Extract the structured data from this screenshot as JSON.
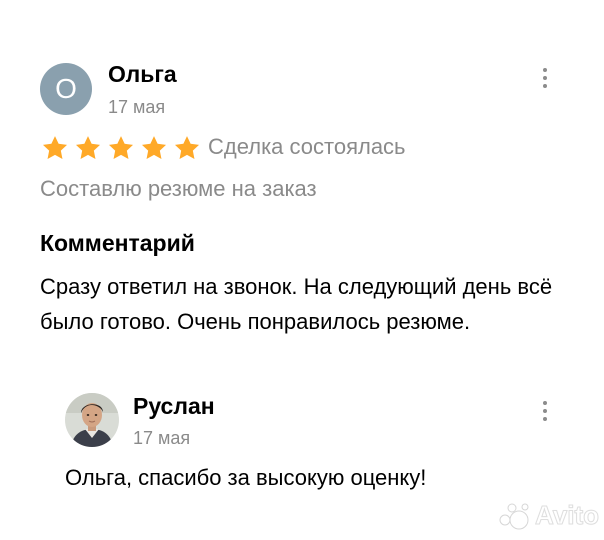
{
  "review": {
    "avatar_letter": "О",
    "avatar_color": "#8aa0ae",
    "author": "Ольга",
    "date": "17 мая",
    "menu_icon": "more-vertical-icon",
    "rating": 5,
    "rating_max": 5,
    "star_color": "#ffa928",
    "deal_status": "Сделка состоялась",
    "service": "Составлю резюме на заказ",
    "comment_heading": "Комментарий",
    "comment_text": "Сразу ответил на звонок. На следующий день всё было готово. Очень понравилось резюме."
  },
  "reply": {
    "author": "Руслан",
    "date": "17 мая",
    "menu_icon": "more-vertical-icon",
    "text": "Ольга, спасибо за высокую оценку!"
  },
  "watermark": {
    "text": "Avito"
  }
}
